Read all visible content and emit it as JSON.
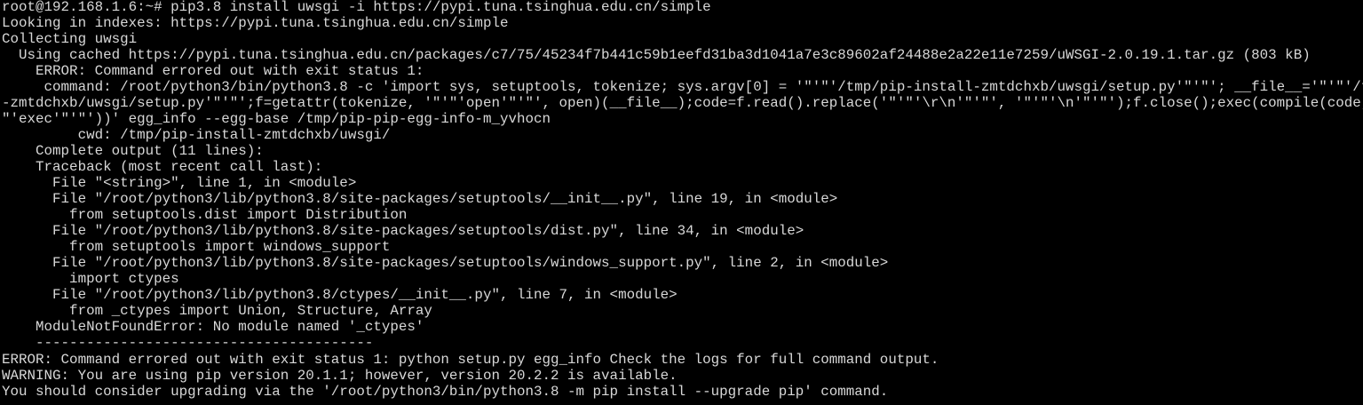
{
  "terminal": {
    "lines": [
      "root@192.168.1.6:~# pip3.8 install uwsgi -i https://pypi.tuna.tsinghua.edu.cn/simple",
      "Looking in indexes: https://pypi.tuna.tsinghua.edu.cn/simple",
      "Collecting uwsgi",
      "  Using cached https://pypi.tuna.tsinghua.edu.cn/packages/c7/75/45234f7b441c59b1eefd31ba3d1041a7e3c89602af24488e2a22e11e7259/uWSGI-2.0.19.1.tar.gz (803 kB)",
      "    ERROR: Command errored out with exit status 1:",
      "     command: /root/python3/bin/python3.8 -c 'import sys, setuptools, tokenize; sys.argv[0] = '\"'\"'/tmp/pip-install-zmtdchxb/uwsgi/setup.py'\"'\"'; __file__='\"'\"'/tmp/pip-install",
      "-zmtdchxb/uwsgi/setup.py'\"'\"';f=getattr(tokenize, '\"'\"'open'\"'\"', open)(__file__);code=f.read().replace('\"'\"'\\r\\n'\"'\"', '\"'\"'\\n'\"'\"');f.close();exec(compile(code, __file__, '",
      "\"'exec'\"'\"'))' egg_info --egg-base /tmp/pip-pip-egg-info-m_yvhocn",
      "         cwd: /tmp/pip-install-zmtdchxb/uwsgi/",
      "    Complete output (11 lines):",
      "    Traceback (most recent call last):",
      "      File \"<string>\", line 1, in <module>",
      "      File \"/root/python3/lib/python3.8/site-packages/setuptools/__init__.py\", line 19, in <module>",
      "        from setuptools.dist import Distribution",
      "      File \"/root/python3/lib/python3.8/site-packages/setuptools/dist.py\", line 34, in <module>",
      "        from setuptools import windows_support",
      "      File \"/root/python3/lib/python3.8/site-packages/setuptools/windows_support.py\", line 2, in <module>",
      "        import ctypes",
      "      File \"/root/python3/lib/python3.8/ctypes/__init__.py\", line 7, in <module>",
      "        from _ctypes import Union, Structure, Array",
      "    ModuleNotFoundError: No module named '_ctypes'",
      "    ----------------------------------------",
      "ERROR: Command errored out with exit status 1: python setup.py egg_info Check the logs for full command output.",
      "WARNING: You are using pip version 20.1.1; however, version 20.2.2 is available.",
      "You should consider upgrading via the '/root/python3/bin/python3.8 -m pip install --upgrade pip' command."
    ]
  }
}
